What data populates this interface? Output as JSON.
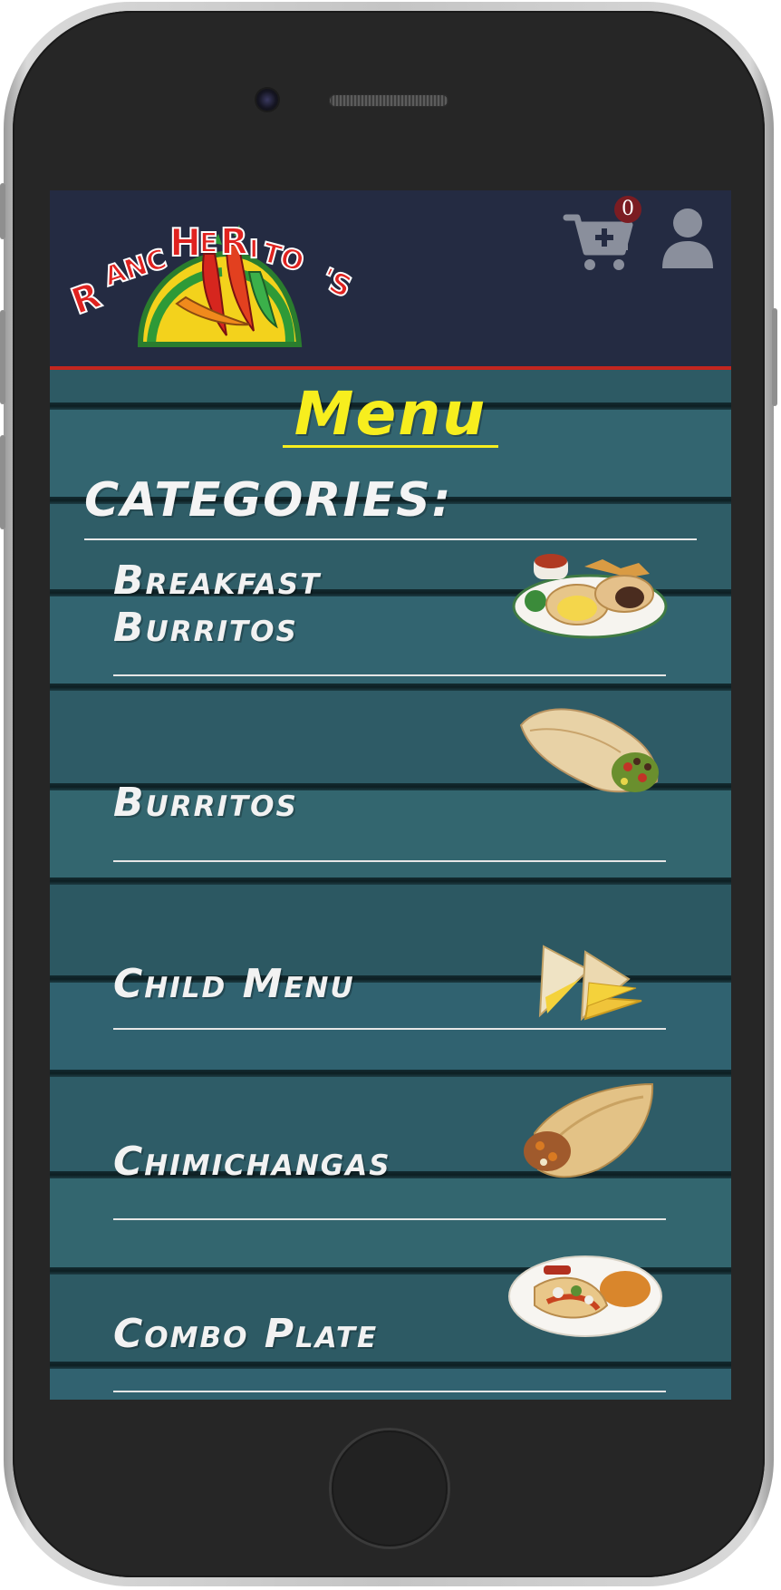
{
  "header": {
    "logo_text": "RancHeRiTo's",
    "cart_count": "0"
  },
  "page": {
    "title": "Menu",
    "categories_heading": "CATEGORIES:"
  },
  "categories": [
    {
      "label_line1": "Breakfast",
      "label_line2": "Burritos",
      "image": "breakfast-burritos-plate"
    },
    {
      "label": "Burritos",
      "image": "burrito"
    },
    {
      "label": "Child Menu",
      "image": "quesadilla"
    },
    {
      "label": "Chimichangas",
      "image": "chimichanga"
    },
    {
      "label": "Combo Plate",
      "image": "combo-plate"
    }
  ],
  "colors": {
    "header_bg": "#242b42",
    "header_border": "#c3261f",
    "title_yellow": "#f7ee1e",
    "wood_teal": "#2f5c66",
    "badge": "#7b1c22",
    "icon_gray": "#8a8f9c"
  }
}
